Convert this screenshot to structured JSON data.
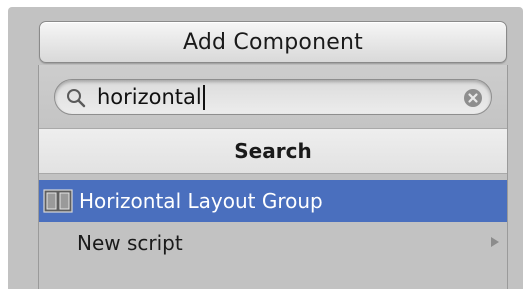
{
  "add_component": {
    "label": "Add Component"
  },
  "search": {
    "value": "horizontal",
    "icon": "magnifier-icon",
    "clear_icon": "clear-search-icon"
  },
  "results_header": {
    "label": "Search"
  },
  "results": [
    {
      "label": "Horizontal Layout Group",
      "icon": "horizontal-layout-group-icon",
      "selected": true
    },
    {
      "label": "New script",
      "has_submenu": true,
      "selected": false
    }
  ],
  "colors": {
    "panel_bg": "#c2c2c2",
    "selection": "#4a6fbe",
    "header_bg": "#e8e8e8"
  }
}
